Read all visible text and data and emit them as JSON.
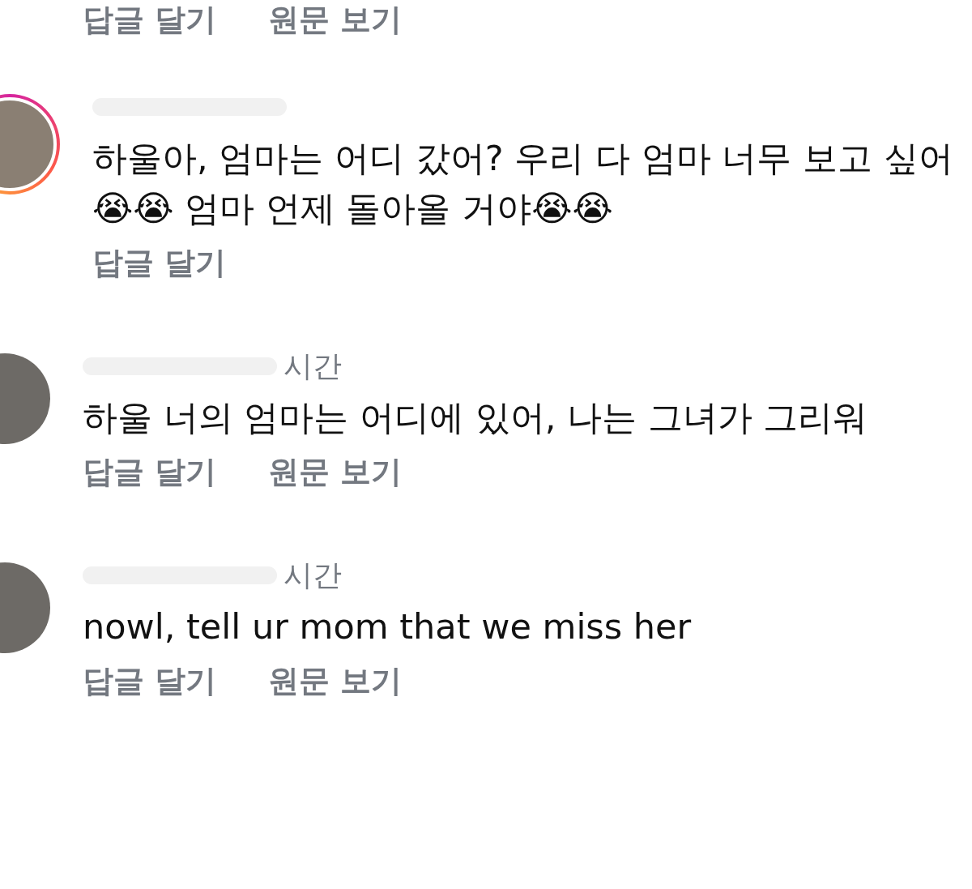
{
  "top_actions": [
    {
      "label": "답글 달기"
    },
    {
      "label": "원문 보기"
    }
  ],
  "comments": [
    {
      "story_ring": true,
      "text": "하울아, 엄마는 어디 갔어? 우리 다 엄마 너무 보고 싶어😭😭 엄마 언제 돌아올 거야😭😭",
      "actions": [
        {
          "label": "답글 달기"
        }
      ]
    },
    {
      "story_ring": false,
      "time": "시간",
      "text": "하울 너의 엄마는 어디에 있어, 나는 그녀가 그리워",
      "actions": [
        {
          "label": "답글 달기"
        },
        {
          "label": "원문 보기"
        }
      ]
    },
    {
      "story_ring": false,
      "time": "시간",
      "text": "nowl, tell ur mom that we miss her",
      "actions": [
        {
          "label": "답글 달기"
        },
        {
          "label": "원문 보기"
        }
      ]
    }
  ]
}
